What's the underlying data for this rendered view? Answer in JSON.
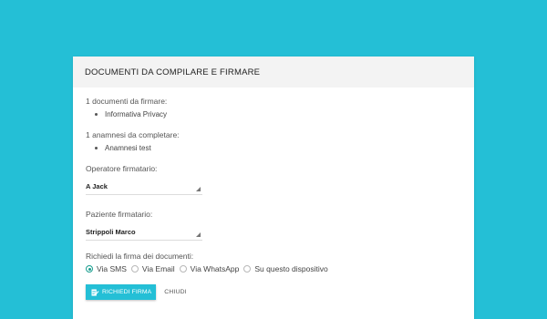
{
  "colors": {
    "background": "#24bfd6",
    "accent": "#24bfd6",
    "radio_checked": "#1a9e8f"
  },
  "modal": {
    "title": "DOCUMENTI DA COMPILARE E FIRMARE",
    "documents_label": "1 documenti da firmare:",
    "documents": [
      "Informativa Privacy"
    ],
    "anamnesi_label": "1 anamnesi da completare:",
    "anamnesi": [
      "Anamnesi test"
    ],
    "operator": {
      "label": "Operatore firmatario:",
      "value": "A Jack"
    },
    "patient": {
      "label": "Paziente firmatario:",
      "value": "Strippoli Marco"
    },
    "sign_method": {
      "label": "Richiedi la firma dei documenti:",
      "options": [
        "Via SMS",
        "Via Email",
        "Via WhatsApp",
        "Su questo dispositivo"
      ],
      "selected": "Via SMS"
    },
    "buttons": {
      "primary_label": "RICHIEDI FIRMA",
      "primary_icon": "edit-document-icon",
      "close_label": "CHIUDI"
    }
  }
}
